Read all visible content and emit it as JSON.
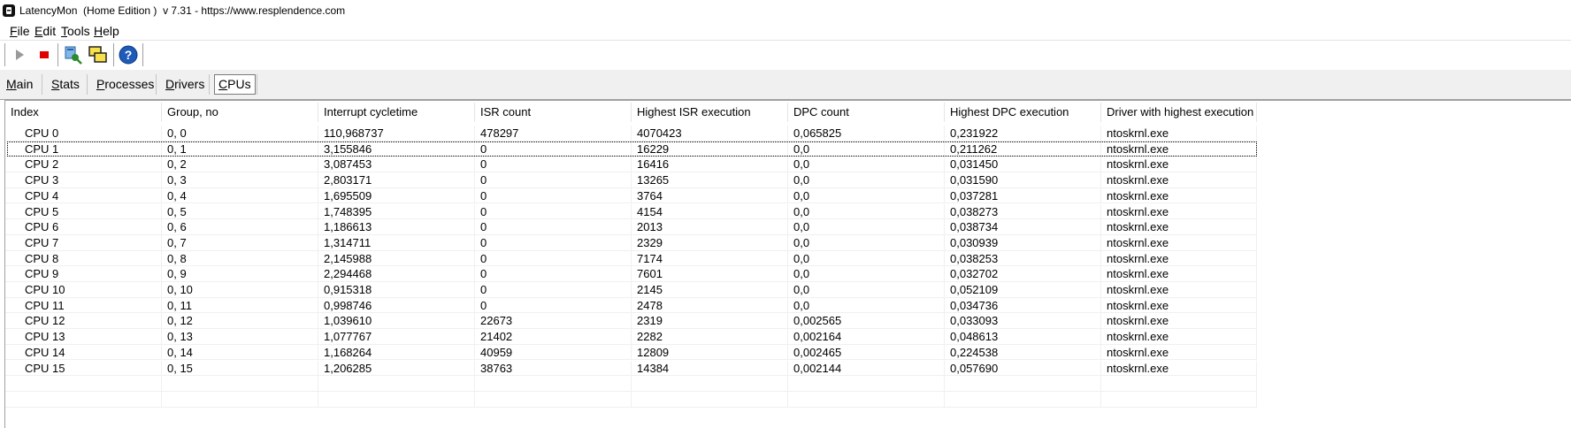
{
  "window": {
    "title": "LatencyMon  (Home Edition )  v 7.31 - https://www.resplendence.com"
  },
  "menu": [
    {
      "label": "File",
      "acc": "F",
      "rest": "ile"
    },
    {
      "label": "Edit",
      "acc": "E",
      "rest": "dit"
    },
    {
      "label": "Tools",
      "acc": "T",
      "rest": "ools"
    },
    {
      "label": "Help",
      "acc": "H",
      "rest": "elp"
    }
  ],
  "toolbar": {
    "buttons": [
      "play-icon",
      "stop-icon",
      "drivers-icon",
      "windows-icon",
      "help-icon"
    ],
    "colors": {
      "play": "#9a9a9a",
      "stop": "#e00000",
      "help": "#1e5bb8"
    }
  },
  "tabs": [
    {
      "label": "Main",
      "acc": "M",
      "rest": "ain",
      "active": false
    },
    {
      "label": "Stats",
      "acc": "S",
      "rest": "tats",
      "active": false
    },
    {
      "label": "Processes",
      "acc": "P",
      "rest": "rocesses",
      "active": false
    },
    {
      "label": "Drivers",
      "acc": "D",
      "rest": "rivers",
      "active": false
    },
    {
      "label": "CPUs",
      "acc": "C",
      "rest": "PUs",
      "active": true
    }
  ],
  "table": {
    "columns": [
      "Index",
      "Group, no",
      "Interrupt cycletime",
      "ISR count",
      "Highest ISR execution",
      "DPC count",
      "Highest DPC execution",
      "Driver with highest execution"
    ],
    "selected_row": 1,
    "rows": [
      [
        "CPU 0",
        "0, 0",
        "110,968737",
        "478297",
        "4070423",
        "0,065825",
        "0,231922",
        "ntoskrnl.exe"
      ],
      [
        "CPU 1",
        "0, 1",
        "3,155846",
        "0",
        "16229",
        "0,0",
        "0,211262",
        "ntoskrnl.exe"
      ],
      [
        "CPU 2",
        "0, 2",
        "3,087453",
        "0",
        "16416",
        "0,0",
        "0,031450",
        "ntoskrnl.exe"
      ],
      [
        "CPU 3",
        "0, 3",
        "2,803171",
        "0",
        "13265",
        "0,0",
        "0,031590",
        "ntoskrnl.exe"
      ],
      [
        "CPU 4",
        "0, 4",
        "1,695509",
        "0",
        "3764",
        "0,0",
        "0,037281",
        "ntoskrnl.exe"
      ],
      [
        "CPU 5",
        "0, 5",
        "1,748395",
        "0",
        "4154",
        "0,0",
        "0,038273",
        "ntoskrnl.exe"
      ],
      [
        "CPU 6",
        "0, 6",
        "1,186613",
        "0",
        "2013",
        "0,0",
        "0,038734",
        "ntoskrnl.exe"
      ],
      [
        "CPU 7",
        "0, 7",
        "1,314711",
        "0",
        "2329",
        "0,0",
        "0,030939",
        "ntoskrnl.exe"
      ],
      [
        "CPU 8",
        "0, 8",
        "2,145988",
        "0",
        "7174",
        "0,0",
        "0,038253",
        "ntoskrnl.exe"
      ],
      [
        "CPU 9",
        "0, 9",
        "2,294468",
        "0",
        "7601",
        "0,0",
        "0,032702",
        "ntoskrnl.exe"
      ],
      [
        "CPU 10",
        "0, 10",
        "0,915318",
        "0",
        "2145",
        "0,0",
        "0,052109",
        "ntoskrnl.exe"
      ],
      [
        "CPU 11",
        "0, 11",
        "0,998746",
        "0",
        "2478",
        "0,0",
        "0,034736",
        "ntoskrnl.exe"
      ],
      [
        "CPU 12",
        "0, 12",
        "1,039610",
        "22673",
        "2319",
        "0,002565",
        "0,033093",
        "ntoskrnl.exe"
      ],
      [
        "CPU 13",
        "0, 13",
        "1,077767",
        "21402",
        "2282",
        "0,002164",
        "0,048613",
        "ntoskrnl.exe"
      ],
      [
        "CPU 14",
        "0, 14",
        "1,168264",
        "40959",
        "12809",
        "0,002465",
        "0,224538",
        "ntoskrnl.exe"
      ],
      [
        "CPU 15",
        "0, 15",
        "1,206285",
        "38763",
        "14384",
        "0,002144",
        "0,057690",
        "ntoskrnl.exe"
      ]
    ]
  }
}
